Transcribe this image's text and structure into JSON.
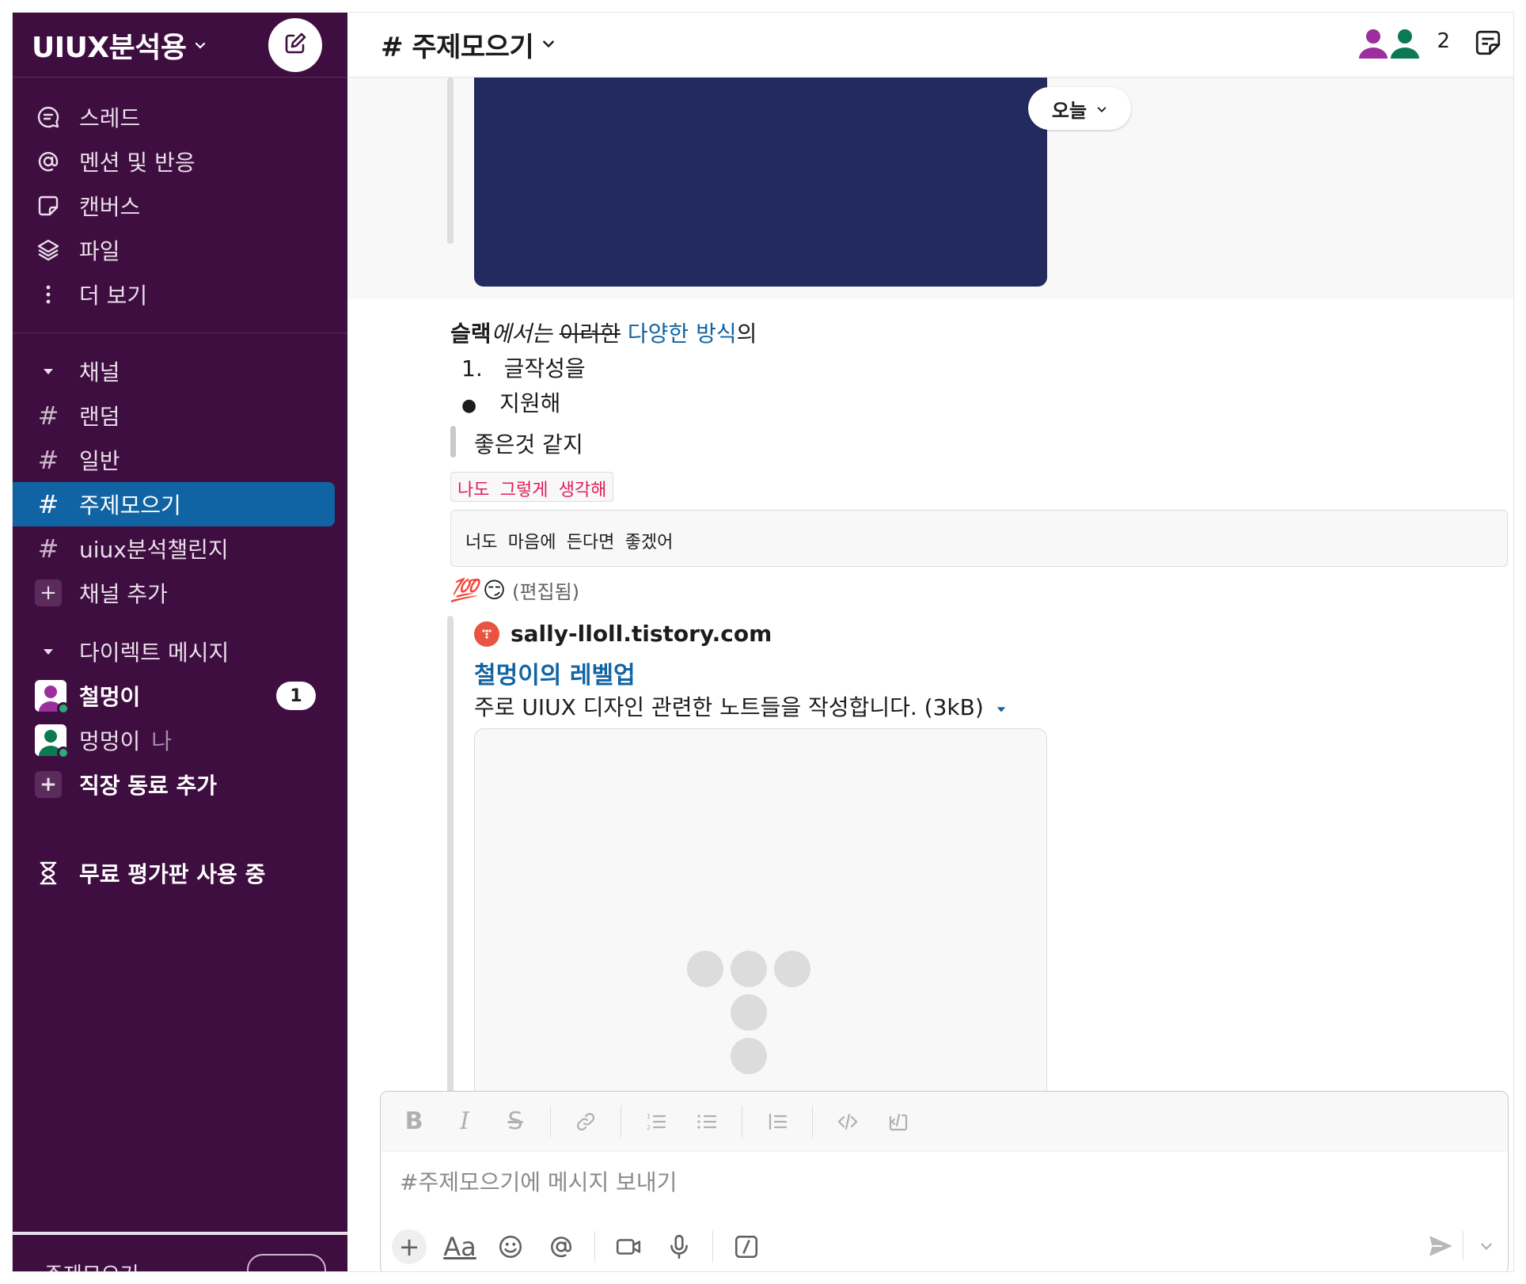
{
  "workspace": {
    "name": "UIUX분석용"
  },
  "sidebar": {
    "nav": [
      {
        "label": "스레드",
        "icon": "threads-icon"
      },
      {
        "label": "멘션 및 반응",
        "icon": "mention-icon"
      },
      {
        "label": "캔버스",
        "icon": "canvas-icon"
      },
      {
        "label": "파일",
        "icon": "files-icon"
      },
      {
        "label": "더 보기",
        "icon": "more-icon"
      }
    ],
    "channels_header": "채널",
    "channels": [
      {
        "label": "랜덤",
        "active": false
      },
      {
        "label": "일반",
        "active": false
      },
      {
        "label": "주제모으기",
        "active": true
      },
      {
        "label": "uiux분석챌린지",
        "active": false
      }
    ],
    "add_channel": "채널 추가",
    "dm_header": "다이렉트 메시지",
    "dms": [
      {
        "label": "철멍이",
        "badge": "1",
        "suffix": ""
      },
      {
        "label": "멍멍이",
        "suffix": "나"
      }
    ],
    "add_coworker": "직장 동료 추가",
    "trial": "무료 평가판 사용 중",
    "footer_label": "주제모으기"
  },
  "channel": {
    "title": "# 주제모으기",
    "member_count": "2"
  },
  "messages": {
    "date_pill": "오늘",
    "rich_line": {
      "bold": "슬랙",
      "italic": "에서는",
      "strike": "이러한",
      "link": "다양한 방식",
      "rest": "의"
    },
    "ordered_item": {
      "num": "1.",
      "text": "글작성을"
    },
    "bullet_item": {
      "bullet": "●",
      "text": "지원해"
    },
    "quote": "좋은것 같지",
    "inline_code": "나도 그렇게 생각해",
    "code_block": "너도 마음에 든다면 좋겠어",
    "reactions": {
      "emoji1": "💯",
      "emoji2": "😏",
      "edited": "(편집됨)"
    },
    "unfurl": {
      "site": "sally-lloll.tistory.com",
      "title": "철멍이의 레벨업",
      "description": "주로 UIUX 디자인 관련한 노트들을 작성합니다. (3kB)"
    }
  },
  "composer": {
    "placeholder": "#주제모으기에 메시지 보내기",
    "format_buttons": [
      "B",
      "I",
      "S"
    ],
    "aa_label": "Aa"
  },
  "colors": {
    "sidebar_bg": "#3f0e40",
    "active_channel": "#1164a3",
    "link": "#1264a3",
    "code_text": "#e01e5a",
    "image_card": "#222a5e"
  }
}
